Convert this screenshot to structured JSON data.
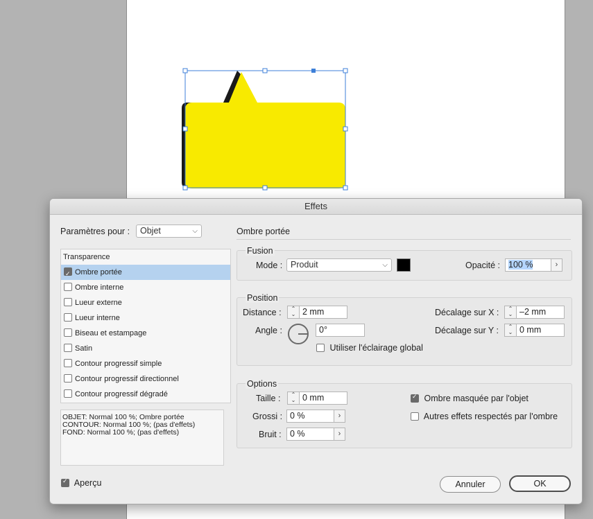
{
  "canvas": {
    "shape": "yellow-speech-bubble",
    "fill_color": "#f8ea00",
    "shadow_color": "#1a1a1a",
    "selection_color": "#3d7fd8"
  },
  "dialog": {
    "title": "Effets",
    "params_label": "Paramètres pour :",
    "params_value": "Objet",
    "section_title": "Ombre portée",
    "list_header": "Transparence",
    "effects": [
      {
        "label": "Ombre portée",
        "checked": true,
        "selected": true
      },
      {
        "label": "Ombre interne",
        "checked": false,
        "selected": false
      },
      {
        "label": "Lueur externe",
        "checked": false,
        "selected": false
      },
      {
        "label": "Lueur interne",
        "checked": false,
        "selected": false
      },
      {
        "label": "Biseau et estampage",
        "checked": false,
        "selected": false
      },
      {
        "label": "Satin",
        "checked": false,
        "selected": false
      },
      {
        "label": "Contour progressif simple",
        "checked": false,
        "selected": false
      },
      {
        "label": "Contour progressif directionnel",
        "checked": false,
        "selected": false
      },
      {
        "label": "Contour progressif dégradé",
        "checked": false,
        "selected": false
      }
    ],
    "summary": "OBJET: Normal 100 %; Ombre portée\nCONTOUR: Normal 100 %; (pas d'effets)\nFOND: Normal 100 %; (pas d'effets)",
    "fusion": {
      "title": "Fusion",
      "mode_label": "Mode :",
      "mode_value": "Produit",
      "color": "#000000",
      "opacity_label": "Opacité :",
      "opacity_value": "100 %"
    },
    "position": {
      "title": "Position",
      "distance_label": "Distance :",
      "distance_value": "2 mm",
      "angle_label": "Angle :",
      "angle_value": "0°",
      "global_light_label": "Utiliser l'éclairage global",
      "offset_x_label": "Décalage sur X :",
      "offset_x_value": "–2 mm",
      "offset_y_label": "Décalage sur Y :",
      "offset_y_value": "0 mm"
    },
    "options": {
      "title": "Options",
      "size_label": "Taille :",
      "size_value": "0 mm",
      "spread_label": "Grossi :",
      "spread_value": "0 %",
      "noise_label": "Bruit :",
      "noise_value": "0 %",
      "knocked_out_label": "Ombre masquée par l'objet",
      "honor_other_label": "Autres effets respectés par l'ombre"
    },
    "preview_label": "Aperçu",
    "cancel_label": "Annuler",
    "ok_label": "OK"
  }
}
